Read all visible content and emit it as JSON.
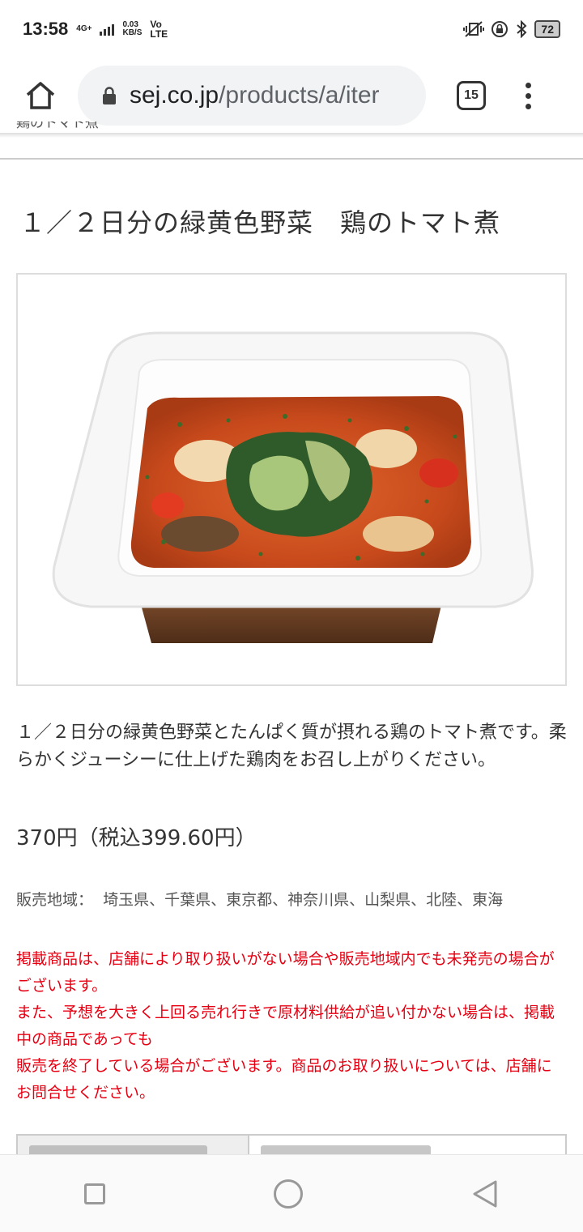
{
  "status_bar": {
    "time": "13:58",
    "net_type": "4G+",
    "speed_value": "0.03",
    "speed_unit": "KB/S",
    "volte_top": "Vo",
    "volte_bottom": "LTE",
    "battery": "72",
    "icons": [
      "vibrate-icon",
      "rotation-lock-icon",
      "bluetooth-icon"
    ]
  },
  "browser": {
    "url_domain": "sej.co.jp",
    "url_path": "/products/a/iter",
    "tab_count": "15",
    "icons": [
      "home-icon",
      "lock-icon",
      "overflow-menu-icon"
    ]
  },
  "page": {
    "breadcrumb_partial": "鶏のトマト煮",
    "title": "１／２日分の緑黄色野菜　鶏のトマト煮",
    "description": "１／２日分の緑黄色野菜とたんぱく質が摂れる鶏のトマト煮です。柔らかくジューシーに仕上げた鶏肉をお召し上がりください。",
    "price": "370円（税込399.60円）",
    "region_label": "販売地域：",
    "region_value": "埼玉県、千葉県、東京都、神奈川県、山梨県、北陸、東海",
    "notice_1": "掲載商品は、店舗により取り扱いがない場合や販売地域内でも未発売の場合がございます。",
    "notice_2": "また、予想を大きく上回る売れ行きで原材料供給が追い付かない場合は、掲載中の商品であっても",
    "notice_3": "販売を終了している場合がございます。商品のお取り扱いについては、店舗にお問合せください。"
  },
  "colors": {
    "notice_red": "#e60012",
    "text": "#333333",
    "url_pill": "#f1f3f4"
  },
  "nav_bar": {
    "icons": [
      "recent-apps-icon",
      "home-circle-icon",
      "back-icon"
    ]
  }
}
